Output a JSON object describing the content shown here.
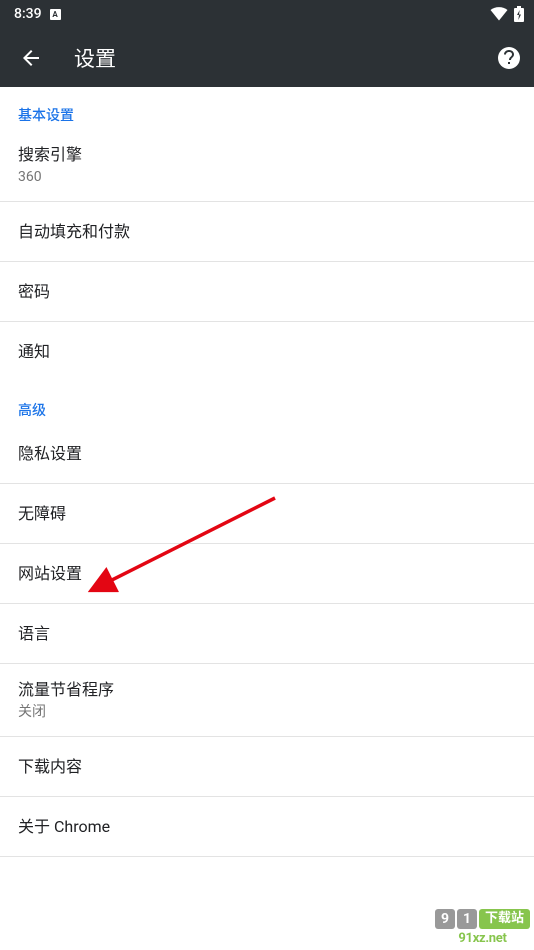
{
  "status": {
    "time": "8:39",
    "indicator": "A"
  },
  "header": {
    "title": "设置"
  },
  "sections": {
    "basic": {
      "header": "基本设置",
      "search_engine": {
        "title": "搜索引擎",
        "subtitle": "360"
      },
      "autofill": {
        "title": "自动填充和付款"
      },
      "passwords": {
        "title": "密码"
      },
      "notifications": {
        "title": "通知"
      }
    },
    "advanced": {
      "header": "高级",
      "privacy": {
        "title": "隐私设置"
      },
      "accessibility": {
        "title": "无障碍"
      },
      "site_settings": {
        "title": "网站设置"
      },
      "language": {
        "title": "语言"
      },
      "data_saver": {
        "title": "流量节省程序",
        "subtitle": "关闭"
      },
      "downloads": {
        "title": "下载内容"
      },
      "about": {
        "title": "关于 Chrome"
      }
    }
  },
  "watermark": {
    "d1": "9",
    "d2": "1",
    "cn": "下载站",
    "site": "91xz.net"
  }
}
